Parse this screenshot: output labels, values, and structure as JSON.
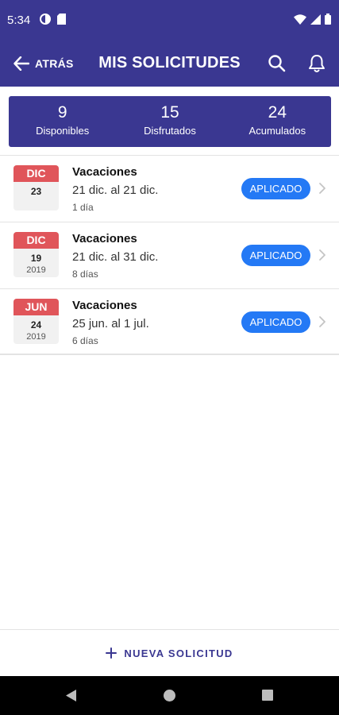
{
  "status_bar": {
    "time": "5:34"
  },
  "header": {
    "back_label": "ATRÁS",
    "title": "MIS SOLICITUDES"
  },
  "summary": [
    {
      "value": "9",
      "label": "Disponibles"
    },
    {
      "value": "15",
      "label": "Disfrutados"
    },
    {
      "value": "24",
      "label": "Acumulados"
    }
  ],
  "requests": [
    {
      "month": "DIC",
      "day": "23",
      "year": "",
      "type": "Vacaciones",
      "dates": "21 dic. al 21 dic.",
      "days": "1 día",
      "status": "APLICADO"
    },
    {
      "month": "DIC",
      "day": "19",
      "year": "2019",
      "type": "Vacaciones",
      "dates": "21 dic. al 31 dic.",
      "days": "8 días",
      "status": "APLICADO"
    },
    {
      "month": "JUN",
      "day": "24",
      "year": "2019",
      "type": "Vacaciones",
      "dates": "25 jun. al 1 jul.",
      "days": "6 días",
      "status": "APLICADO"
    }
  ],
  "footer": {
    "new_request_label": "NUEVA SOLICITUD"
  },
  "colors": {
    "primary": "#3a3791",
    "calendar_red": "#e0555a",
    "status_blue": "#2479f5"
  },
  "icons": {
    "back": "arrow-left-icon",
    "search": "search-icon",
    "notifications": "bell-icon",
    "add": "plus-icon",
    "chevron": "chevron-right-icon"
  }
}
